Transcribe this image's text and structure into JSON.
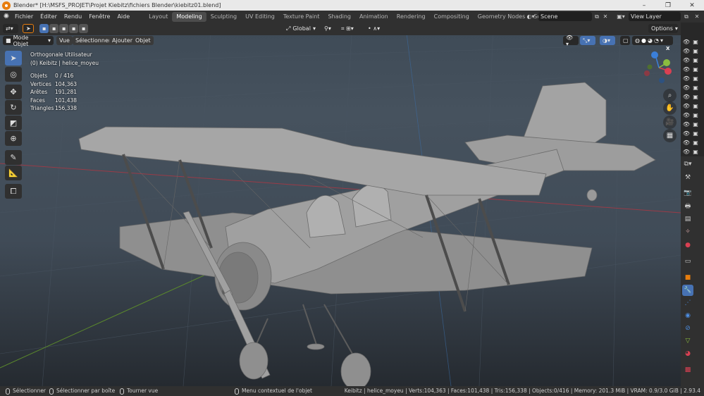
{
  "titlebar": {
    "title": "Blender* [H:\\MSFS_PROJET\\Projet Kiebitz\\fichiers Blender\\kiebitz01.blend]",
    "minimize": "–",
    "maximize": "❐",
    "close": "✕"
  },
  "menu": {
    "items": [
      "Fichier",
      "Éditer",
      "Rendu",
      "Fenêtre",
      "Aide"
    ]
  },
  "workspaces": {
    "tabs": [
      "Layout",
      "Modeling",
      "Sculpting",
      "UV Editing",
      "Texture Paint",
      "Shading",
      "Animation",
      "Rendering",
      "Compositing",
      "Geometry Nodes",
      "Scripting"
    ],
    "active": "Modeling",
    "add": "+"
  },
  "scene": {
    "label": "Scene"
  },
  "view_layer": {
    "label": "View Layer"
  },
  "header": {
    "transform_orientation": "Global",
    "options": "Options",
    "mode": "Mode Objet",
    "vue": "Vue",
    "selectionner": "Sélectionner",
    "ajouter": "Ajouter",
    "objet": "Objet"
  },
  "overlay": {
    "view_name": "Orthogonale Utilisateur",
    "object_name": "(0) Keibitz | helice_moyeu"
  },
  "stats": [
    {
      "label": "Objets",
      "value": "0 / 416"
    },
    {
      "label": "Vertices",
      "value": "104,363"
    },
    {
      "label": "Arêtes",
      "value": "191,281"
    },
    {
      "label": "Faces",
      "value": "101,438"
    },
    {
      "label": "Triangles",
      "value": "156,338"
    }
  ],
  "gizmo": {
    "x": "X",
    "y": "Y",
    "z": "Z"
  },
  "statusbar": {
    "select": "Sélectionner",
    "box_select": "Sélectionner par boîte",
    "rotate_view": "Tourner vue",
    "context_menu": "Menu contextuel de l'objet",
    "info": "Keibitz | helice_moyeu | Verts:104,363 | Faces:101,438 | Tris:156,338 | Objects:0/416 | Memory: 201.3 MiB | VRAM: 0.9/3.0 GiB | 2.93.4"
  },
  "colors": {
    "accent": "#4772b3",
    "x_axis": "#d94052",
    "y_axis": "#8bbd3f",
    "z_axis": "#3b7fd9"
  }
}
